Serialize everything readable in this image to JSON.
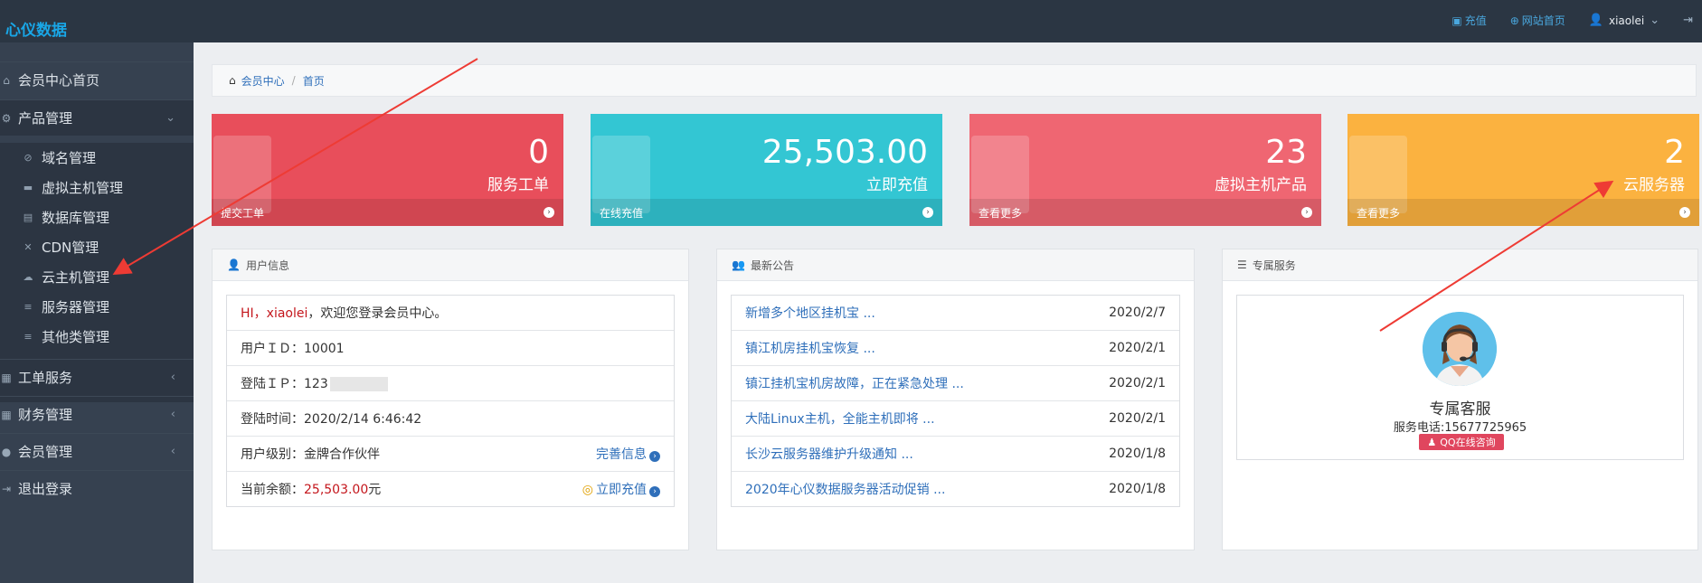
{
  "brand": "心仪数据",
  "topbar": {
    "recharge": "充值",
    "website_home": "网站首页",
    "username": "xiaolei"
  },
  "sidebar": {
    "items": [
      {
        "label": "会员中心首页"
      },
      {
        "label": "产品管理"
      },
      {
        "label": "工单服务"
      },
      {
        "label": "财务管理"
      },
      {
        "label": "会员管理"
      },
      {
        "label": "退出登录"
      }
    ],
    "sub_items": [
      {
        "label": "域名管理"
      },
      {
        "label": "虚拟主机管理"
      },
      {
        "label": "数据库管理"
      },
      {
        "label": "CDN管理"
      },
      {
        "label": "云主机管理"
      },
      {
        "label": "服务器管理"
      },
      {
        "label": "其他类管理"
      }
    ]
  },
  "breadcrumb": {
    "root": "会员中心",
    "current": "首页"
  },
  "stats": [
    {
      "number": "0",
      "label": "服务工单",
      "footer": "提交工单",
      "color": "#e84e5b"
    },
    {
      "number": "25,503.00",
      "label": "立即充值",
      "footer": "在线充值",
      "color": "#33c6d3"
    },
    {
      "number": "23",
      "label": "虚拟主机产品",
      "footer": "查看更多",
      "color": "#ef6672"
    },
    {
      "number": "2",
      "label": "云服务器",
      "footer": "查看更多",
      "color": "#fbb240"
    }
  ],
  "user_panel": {
    "title": "用户信息",
    "greet_prefix": "HI，",
    "username": "xiaolei",
    "greet_suffix": "，欢迎您登录会员中心。",
    "user_id_label": "用户ＩＤ：",
    "user_id": "10001",
    "ip_label": "登陆ＩＰ：",
    "ip": "123",
    "time_label": "登陆时间：",
    "time": "2020/2/14 6:46:42",
    "level_label": "用户级别：",
    "level": "金牌合作伙伴",
    "complete_info": "完善信息",
    "balance_label": "当前余额：",
    "balance": "25,503.00",
    "balance_unit": "元",
    "recharge_now": "立即充值"
  },
  "news_panel": {
    "title": "最新公告",
    "items": [
      {
        "title": "新增多个地区挂机宝 ...",
        "date": "2020/2/7"
      },
      {
        "title": "镇江机房挂机宝恢复 ...",
        "date": "2020/2/1"
      },
      {
        "title": "镇江挂机宝机房故障，正在紧急处理 ...",
        "date": "2020/2/1"
      },
      {
        "title": "大陆Linux主机，全能主机即将 ...",
        "date": "2020/2/1"
      },
      {
        "title": "长沙云服务器维护升级通知 ...",
        "date": "2020/1/8"
      },
      {
        "title": "2020年心仪数据服务器活动促销 ...",
        "date": "2020/1/8"
      }
    ]
  },
  "service_panel": {
    "title": "专属服务",
    "name": "专属客服",
    "phone": "服务电话:15677725965",
    "qq_button": "QQ在线咨询"
  },
  "colors": {
    "arrow": "#ee3b34",
    "sidebar": "#364150",
    "topbar": "#2b3643",
    "link": "#2f6fba"
  }
}
